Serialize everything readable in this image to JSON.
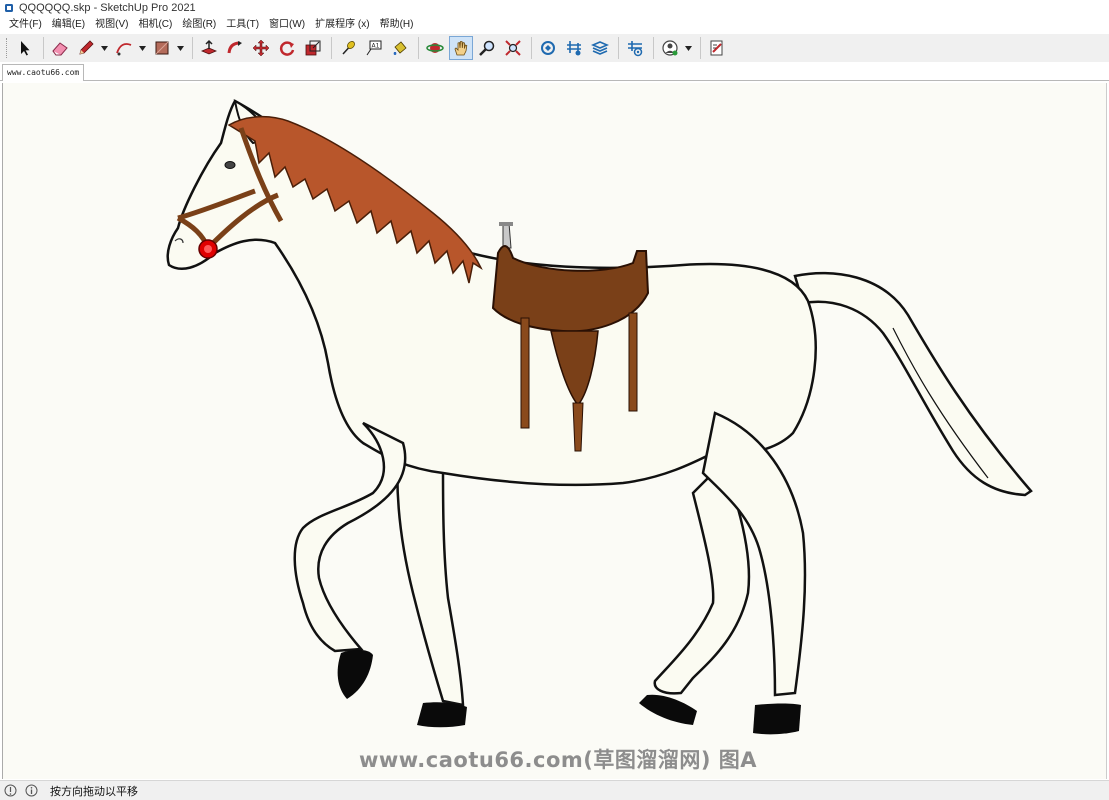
{
  "window": {
    "title": "QQQQQQ.skp - SketchUp Pro 2021"
  },
  "menubar": {
    "items": [
      {
        "label": "文件(F)"
      },
      {
        "label": "编辑(E)"
      },
      {
        "label": "视图(V)"
      },
      {
        "label": "相机(C)"
      },
      {
        "label": "绘图(R)"
      },
      {
        "label": "工具(T)"
      },
      {
        "label": "窗口(W)"
      },
      {
        "label": "扩展程序 (x)"
      },
      {
        "label": "帮助(H)"
      }
    ]
  },
  "toolbar": {
    "tools": [
      {
        "icon": "select-arrow-icon"
      },
      {
        "icon": "eraser-icon"
      },
      {
        "icon": "pencil-line-icon",
        "has_dropdown": true
      },
      {
        "icon": "arc-icon",
        "has_dropdown": true
      },
      {
        "icon": "rectangle-icon",
        "has_dropdown": true
      },
      {
        "icon": "push-pull-icon"
      },
      {
        "icon": "follow-me-icon"
      },
      {
        "icon": "move-icon"
      },
      {
        "icon": "rotate-icon"
      },
      {
        "icon": "scale-icon"
      },
      {
        "icon": "tape-measure-icon"
      },
      {
        "icon": "text-label-icon"
      },
      {
        "icon": "paint-bucket-icon"
      },
      {
        "icon": "orbit-icon"
      },
      {
        "icon": "pan-hand-icon",
        "active": true
      },
      {
        "icon": "zoom-icon"
      },
      {
        "icon": "zoom-extents-icon"
      },
      {
        "icon": "3d-warehouse-icon"
      },
      {
        "icon": "extension-warehouse-icon"
      },
      {
        "icon": "layout-icon"
      },
      {
        "icon": "extension-manager-icon"
      },
      {
        "icon": "profile-icon",
        "has_dropdown": true
      },
      {
        "icon": "license-icon"
      }
    ]
  },
  "tabs": {
    "scene_tab": "www.caotu66.com"
  },
  "viewport": {
    "background": "#fbfbf6",
    "model": "white horse with brown saddle, mane and bridle",
    "watermark": "www.caotu66.com(草图溜溜网) 图A"
  },
  "statusbar": {
    "hint": "按方向拖动以平移"
  },
  "colors": {
    "mane": "#b8562b",
    "saddle": "#7a4018",
    "horse_body": "#ffffff",
    "hoof": "#0a0a0a",
    "bridle_ring": "#e00000"
  }
}
